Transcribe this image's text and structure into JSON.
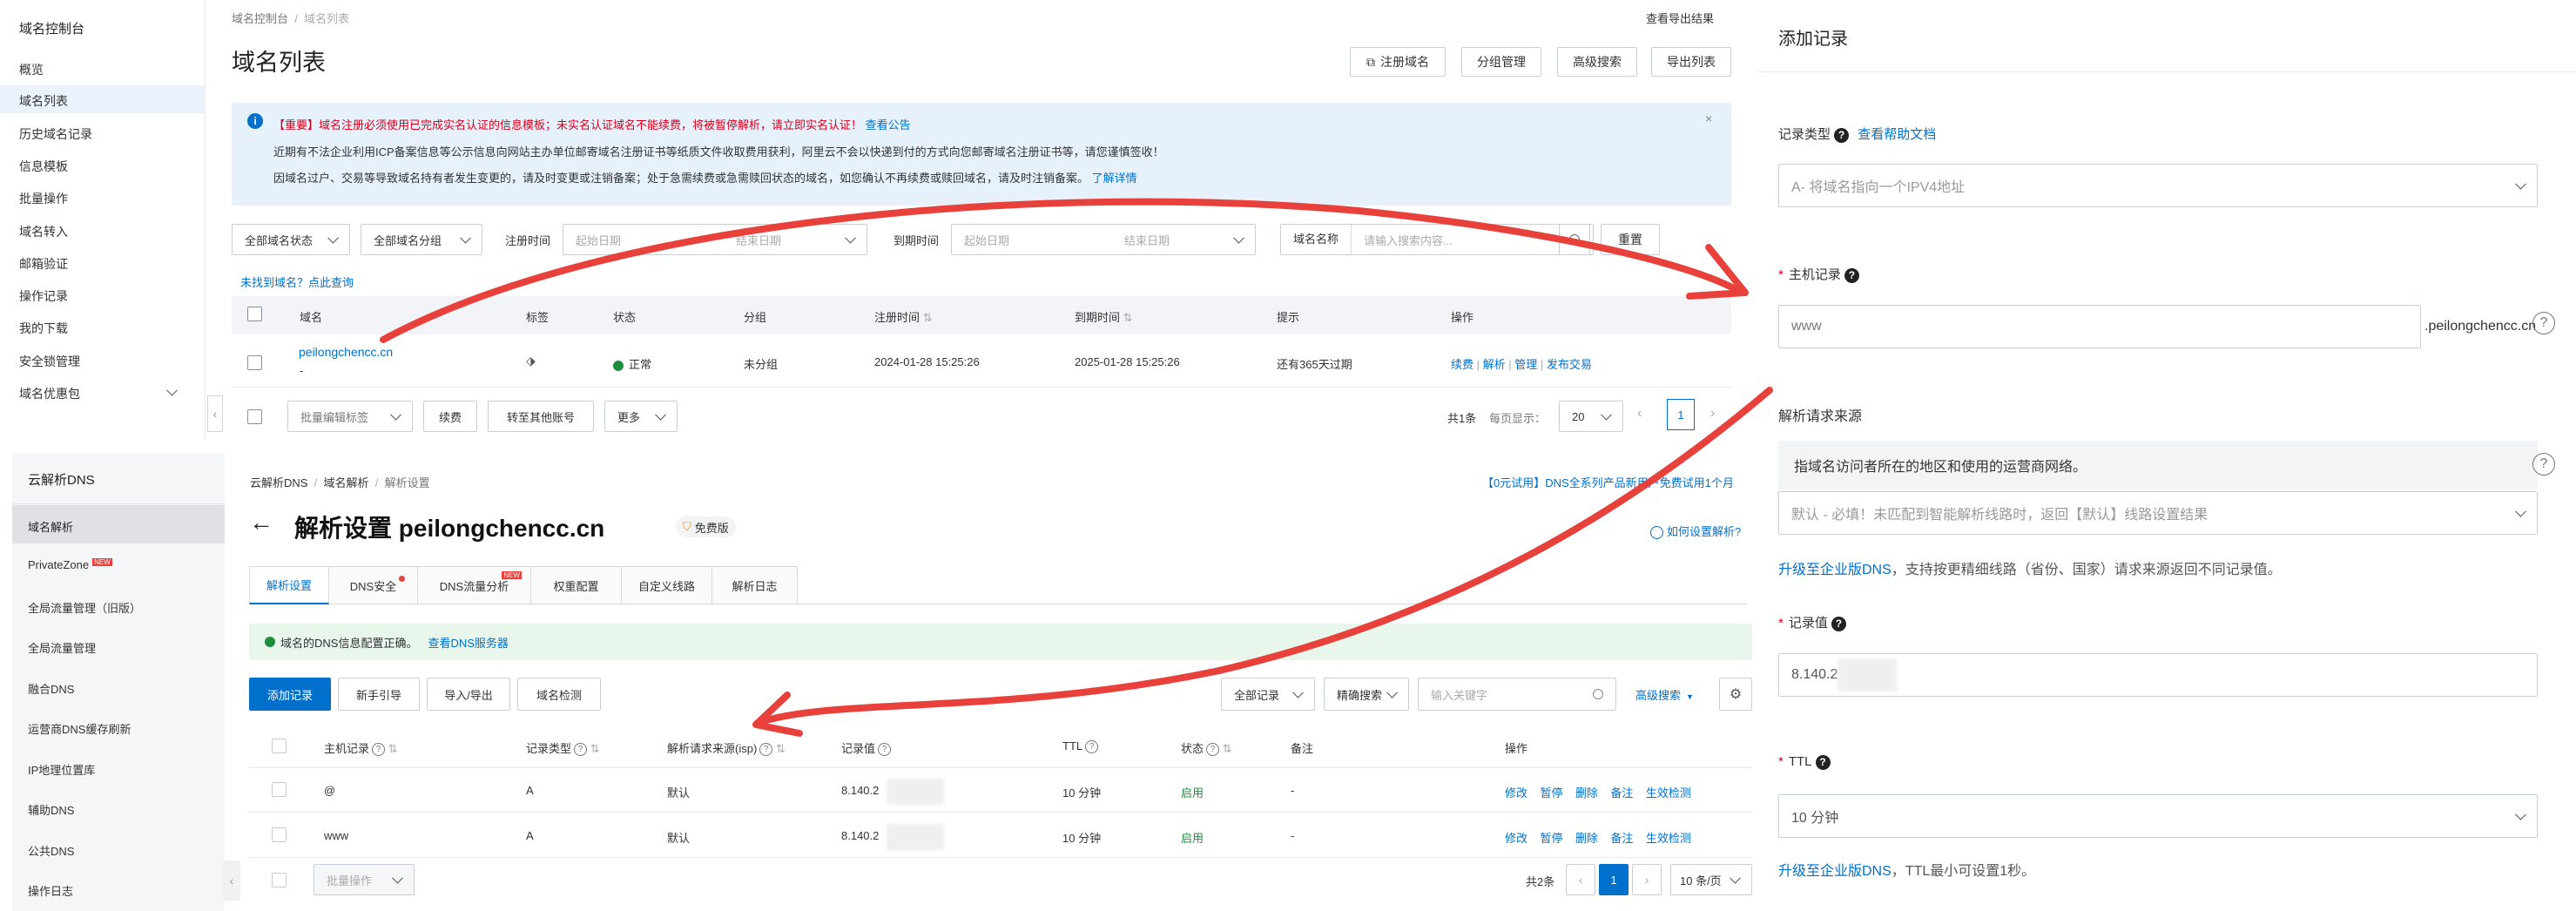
{
  "topleft": {
    "sidebar": {
      "title": "域名控制台",
      "items": [
        "概览",
        "域名列表",
        "历史域名记录",
        "信息模板",
        "批量操作",
        "域名转入",
        "邮箱验证",
        "操作记录",
        "我的下载",
        "安全锁管理",
        "域名优惠包"
      ]
    },
    "breadcrumb": [
      "域名控制台",
      "域名列表"
    ],
    "export_link": "查看导出结果",
    "title": "域名列表",
    "top_buttons": [
      "注册域名",
      "分组管理",
      "高级搜索",
      "导出列表"
    ],
    "notice": {
      "line1_red": "【重要】域名注册必须使用已完成实名认证的信息模板；未实名认证域名不能续费，将被暂停解析，请立即实名认证！",
      "line1_link": "查看公告",
      "line2": "近期有不法企业利用ICP备案信息等公示信息向网站主办单位邮寄域名注册证书等纸质文件收取费用获利，阿里云不会以快递到付的方式向您邮寄域名注册证书等，请您谨慎签收！",
      "line3": "因域名过户、交易等导致域名持有者发生变更的，请及时变更或注销备案；处于急需续费或急需赎回状态的域名，如您确认不再续费或赎回域名，请及时注销备案。",
      "line3_link": "了解详情"
    },
    "filters": {
      "status": "全部域名状态",
      "group": "全部域名分组",
      "reg_label": "注册时间",
      "start": "起始日期",
      "end": "结束日期",
      "exp_label": "到期时间",
      "name_label": "域名名称",
      "search_placeholder": "请输入搜索内容...",
      "reset": "重置"
    },
    "not_found": "未找到域名？点此查询",
    "table": {
      "headers": [
        "域名",
        "标签",
        "状态",
        "分组",
        "注册时间",
        "到期时间",
        "提示",
        "操作"
      ],
      "row": {
        "domain": "peilongchencc.cn",
        "sub": "-",
        "status": "正常",
        "group": "未分组",
        "reg": "2024-01-28 15:25:26",
        "exp": "2025-01-28 15:25:26",
        "tip": "还有365天过期",
        "actions": [
          "续费",
          "解析",
          "管理",
          "发布交易"
        ]
      }
    },
    "footer": {
      "batch_tag": "批量编辑标签",
      "renew": "续费",
      "transfer": "转至其他账号",
      "more": "更多",
      "total": "共1条",
      "per_page_label": "每页显示：",
      "per_page": "20",
      "page": "1"
    }
  },
  "bottomleft": {
    "sidebar": {
      "title": "云解析DNS",
      "items": [
        "域名解析",
        "PrivateZone",
        "全局流量管理（旧版）",
        "全局流量管理",
        "融合DNS",
        "运营商DNS缓存刷新",
        "IP地理位置库",
        "辅助DNS",
        "公共DNS",
        "操作日志"
      ],
      "new_badge": "NEW"
    },
    "breadcrumb": [
      "云解析DNS",
      "域名解析",
      "解析设置"
    ],
    "promo": "【0元试用】DNS全系列产品新用户免费试用1个月",
    "title": "解析设置 peilongchencc.cn",
    "free_badge": "免费版",
    "howto": "如何设置解析?",
    "tabs": [
      "解析设置",
      "DNS安全",
      "DNS流量分析",
      "权重配置",
      "自定义线路",
      "解析日志"
    ],
    "ok_text": "域名的DNS信息配置正确。",
    "ok_link": "查看DNS服务器",
    "toolbar": {
      "add": "添加记录",
      "guide": "新手引导",
      "import": "导入/导出",
      "check": "域名检测",
      "all_records": "全部记录",
      "exact": "精确搜索",
      "keyword_placeholder": "输入关键字",
      "advanced": "高级搜索"
    },
    "table": {
      "headers": [
        "主机记录",
        "记录类型",
        "解析请求来源(isp)",
        "记录值",
        "TTL",
        "状态",
        "备注",
        "操作"
      ],
      "rows": [
        {
          "host": "@",
          "type": "A",
          "isp": "默认",
          "value": "8.140.2",
          "ttl": "10 分钟",
          "status": "启用",
          "note": "-"
        },
        {
          "host": "www",
          "type": "A",
          "isp": "默认",
          "value": "8.140.2",
          "ttl": "10 分钟",
          "status": "启用",
          "note": "-"
        }
      ],
      "actions": [
        "修改",
        "暂停",
        "删除",
        "备注",
        "生效检测"
      ]
    },
    "footer": {
      "batch": "批量操作",
      "total": "共2条",
      "page": "1",
      "per_page": "10 条/页"
    }
  },
  "right": {
    "title": "添加记录",
    "type_label": "记录类型",
    "help_doc": "查看帮助文档",
    "type_value": "A- 将域名指向一个IPV4地址",
    "host_label": "主机记录",
    "host_value": "www",
    "host_suffix": ".peilongchencc.cn",
    "isp_label": "解析请求来源",
    "isp_hint": "指域名访问者所在的地区和使用的运营商网络。",
    "isp_value": "默认 - 必填！未匹配到智能解析线路时，返回【默认】线路设置结果",
    "upgrade1_link": "升级至企业版DNS",
    "upgrade1_text": "，支持按更精细线路（省份、国家）请求来源返回不同记录值。",
    "value_label": "记录值",
    "value_value": "8.140.2",
    "ttl_label": "TTL",
    "ttl_value": "10 分钟",
    "upgrade2_link": "升级至企业版DNS",
    "upgrade2_text": "，TTL最小可设置1秒。"
  },
  "colors": {
    "accent": "#0070cc",
    "annotation": "#e8413c",
    "ok_bg": "#e8f6ec",
    "notice_bg": "#e6f1fb"
  }
}
